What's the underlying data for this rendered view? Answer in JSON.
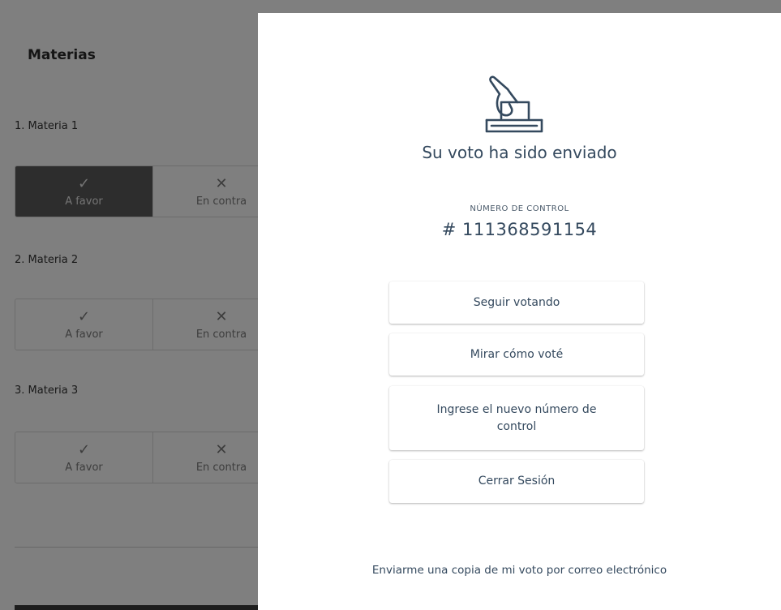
{
  "page": {
    "title": "Materias",
    "materias": [
      {
        "label": "1. Materia 1",
        "options": [
          {
            "symbol": "✓",
            "label": "A favor",
            "selected": true
          },
          {
            "symbol": "✕",
            "label": "En contra",
            "selected": false
          }
        ]
      },
      {
        "label": "2. Materia 2",
        "options": [
          {
            "symbol": "✓",
            "label": "A favor",
            "selected": false
          },
          {
            "symbol": "✕",
            "label": "En contra",
            "selected": false
          }
        ]
      },
      {
        "label": "3. Materia 3",
        "options": [
          {
            "symbol": "✓",
            "label": "A favor",
            "selected": false
          },
          {
            "symbol": "✕",
            "label": "En contra",
            "selected": false
          }
        ]
      }
    ]
  },
  "modal": {
    "icon": "ballot-box-icon",
    "heading": "Su voto ha sido enviado",
    "control_label": "NÚMERO DE CONTROL",
    "control_number": "# 111368591154",
    "buttons": {
      "continue": "Seguir votando",
      "review": "Mirar cómo voté",
      "new_control": "Ingrese el nuevo número de control",
      "logout": "Cerrar Sesión"
    },
    "email_link": "Enviarme una copia de mi voto por correo electrónico"
  },
  "colors": {
    "overlay": "#000000",
    "text_primary": "#34495e",
    "selected_option": "#5a5a5a"
  }
}
